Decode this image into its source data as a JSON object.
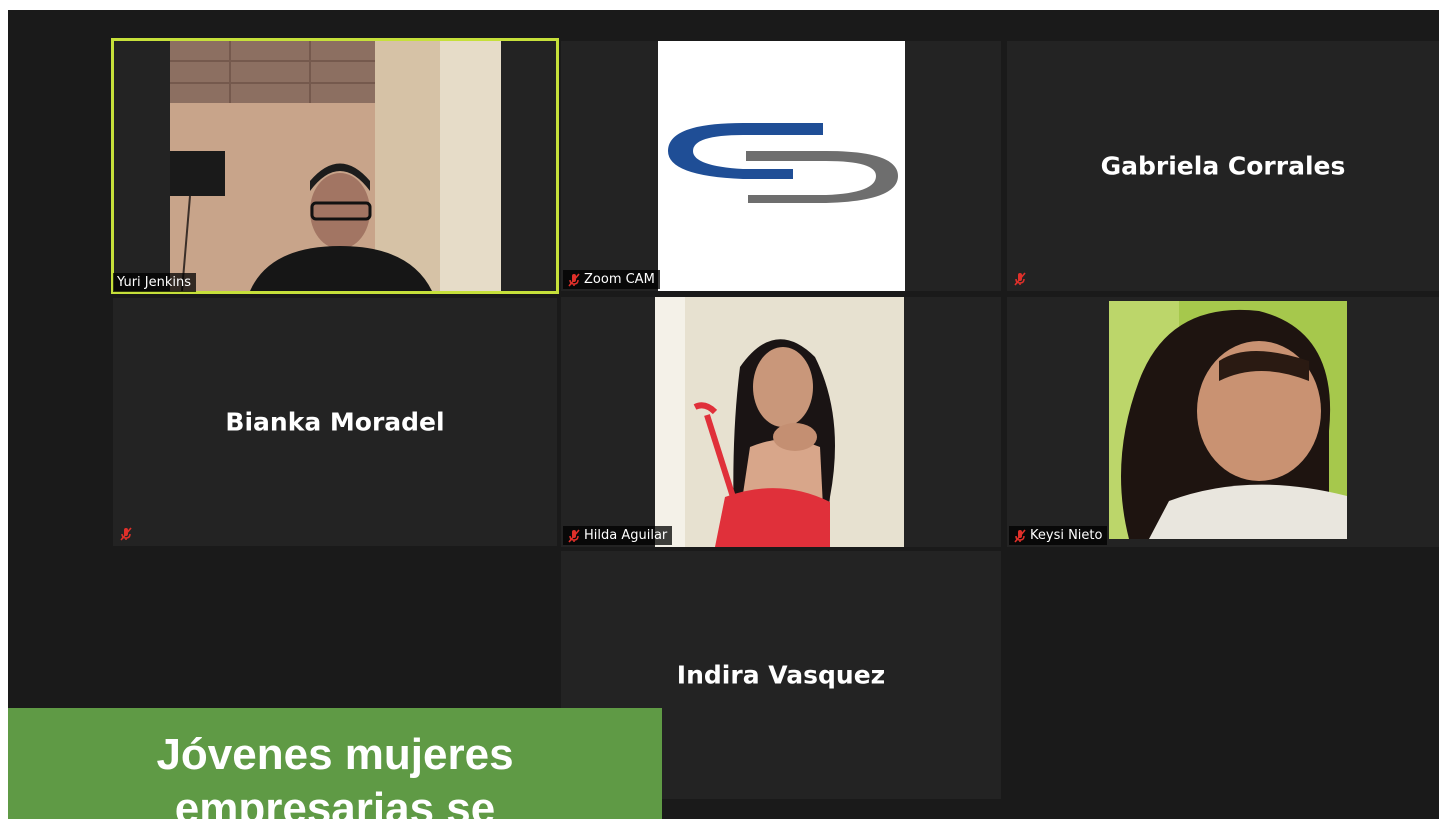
{
  "participants": [
    {
      "id": "yuri",
      "name": "Yuri Jenkins",
      "muted": false,
      "video": true,
      "active": true,
      "label_shown": true
    },
    {
      "id": "zoomcam",
      "name": "Zoom CAM",
      "muted": true,
      "video": true,
      "label_shown": true
    },
    {
      "id": "gabriela",
      "name": "Gabriela Corrales",
      "muted": true,
      "video": false,
      "label_shown": false
    },
    {
      "id": "bianka",
      "name": "Bianka Moradel",
      "muted": true,
      "video": false,
      "label_shown": false
    },
    {
      "id": "hilda",
      "name": "Hilda Aguilar",
      "muted": true,
      "video": true,
      "label_shown": true
    },
    {
      "id": "keysi",
      "name": "Keysi Nieto",
      "muted": true,
      "video": true,
      "label_shown": true
    },
    {
      "id": "indira",
      "name": "Indira Vasquez",
      "muted": false,
      "video": false,
      "label_shown": false
    }
  ],
  "caption": {
    "line1": "Jóvenes mujeres",
    "line2": "empresarias se"
  },
  "colors": {
    "active_speaker_border": "#c6e03a",
    "mute_icon": "#e0302a",
    "caption_background": "#5f9a45",
    "logo_blue": "#1f4e96",
    "logo_gray": "#6e6e6e"
  },
  "icons": {
    "mute": "microphone-muted-icon"
  }
}
